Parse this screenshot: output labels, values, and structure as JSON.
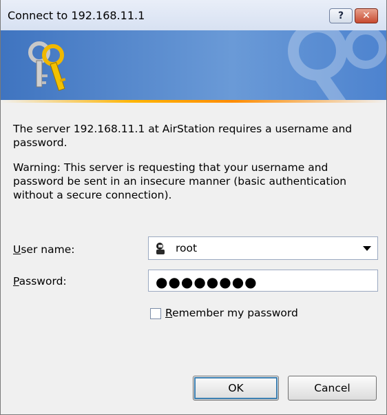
{
  "window": {
    "title": "Connect to 192.168.11.1",
    "help_label": "?",
    "close_label": "✕"
  },
  "message": {
    "line1": "The server 192.168.11.1 at AirStation requires a username and password.",
    "warning": "Warning: This server is requesting that your username and password be sent in an insecure manner (basic authentication without a secure connection)."
  },
  "form": {
    "username_label_prefix": "U",
    "username_label_rest": "ser name:",
    "username_value": "root",
    "password_label_prefix": "P",
    "password_label_rest": "assword:",
    "password_value": "●●●●●●●●",
    "remember_label_prefix": "R",
    "remember_label_rest": "emember my password",
    "remember_checked": false
  },
  "buttons": {
    "ok": "OK",
    "cancel": "Cancel"
  },
  "colors": {
    "banner_blue": "#3f74c0",
    "accent_orange": "#ff8c00"
  },
  "icons": {
    "banner": "keys-icon",
    "user": "user-icon"
  }
}
